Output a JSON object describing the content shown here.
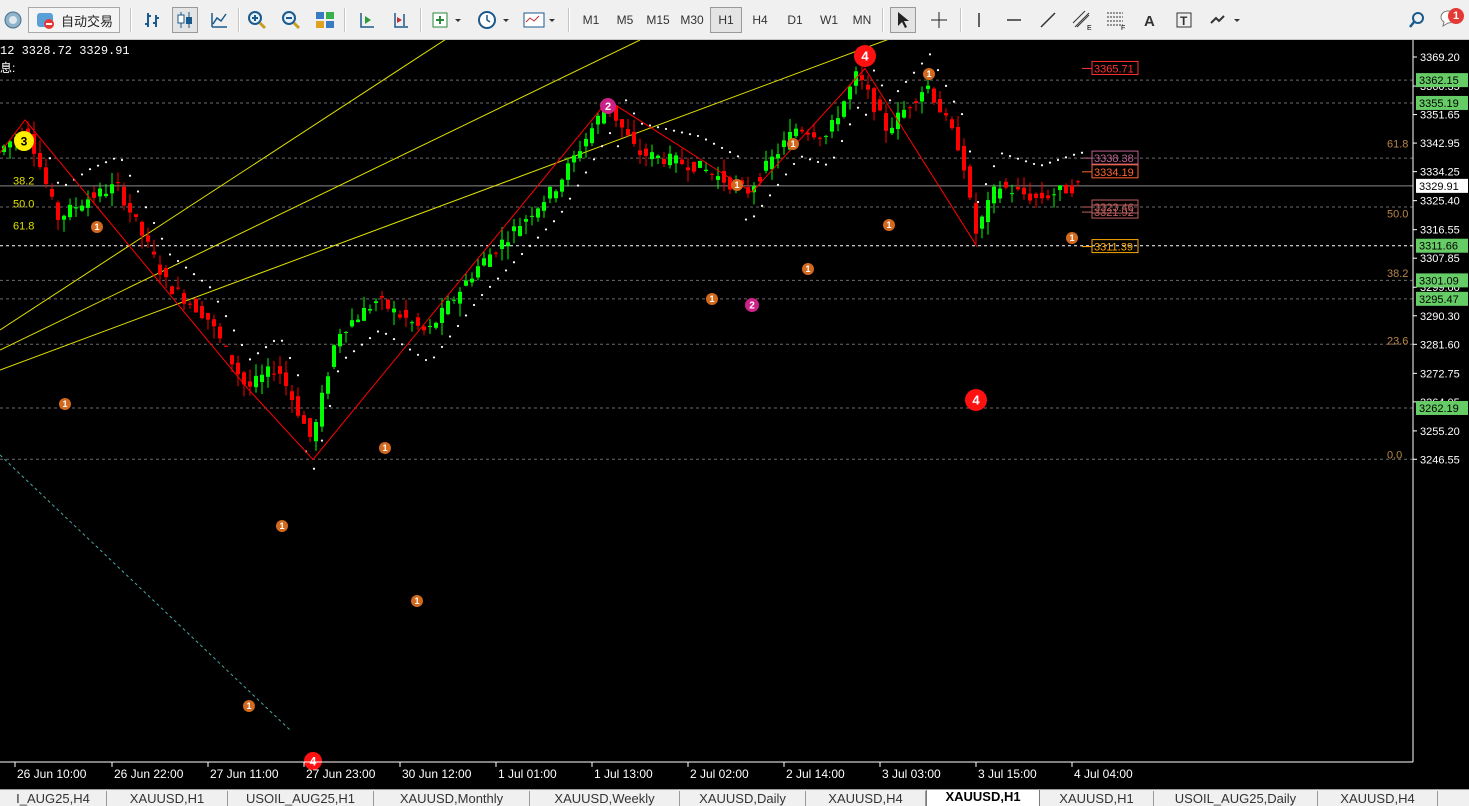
{
  "toolbar": {
    "auto_trade_label": "自动交易",
    "timeframes": [
      "M1",
      "M5",
      "M15",
      "M30",
      "H1",
      "H4",
      "D1",
      "W1",
      "MN"
    ],
    "active_timeframe": "H1",
    "notification_count": "1"
  },
  "chart": {
    "info_line": "12 3328.72 3329.91",
    "info_line2": "息:",
    "price_ticks": [
      "3369.20",
      "3360.35",
      "3351.65",
      "3342.95",
      "3334.25",
      "3325.40",
      "3316.55",
      "3307.85",
      "3299.00",
      "3290.30",
      "3281.60",
      "3272.75",
      "3264.05",
      "3255.20",
      "3246.55"
    ],
    "time_labels": [
      "26 Jun 10:00",
      "26 Jun 22:00",
      "27 Jun 11:00",
      "27 Jun 23:00",
      "30 Jun 12:00",
      "1 Jul 01:00",
      "1 Jul 13:00",
      "2 Jul 02:00",
      "2 Jul 14:00",
      "3 Jul 03:00",
      "3 Jul 15:00",
      "4 Jul 04:00"
    ],
    "current_price": "3329.91",
    "level_labels": [
      {
        "text": "3362.15",
        "bg": "#66cc66"
      },
      {
        "text": "3355.19",
        "bg": "#66cc66"
      },
      {
        "text": "3311.66",
        "bg": "#66cc66"
      },
      {
        "text": "3301.09",
        "bg": "#66cc66"
      },
      {
        "text": "3295.47",
        "bg": "#66cc66"
      },
      {
        "text": "3262.19",
        "bg": "#66cc66"
      }
    ],
    "marker_labels": [
      "3365.71",
      "3338.38",
      "3334.19",
      "3323.46",
      "3321.92",
      "3311.39"
    ],
    "fib_right": [
      "61.8",
      "50.0",
      "38.2",
      "23.6",
      "0.0"
    ],
    "fib_left": [
      "38.2",
      "50.0",
      "61.8"
    ],
    "wave_labels": [
      "3",
      "2",
      "4",
      "4",
      "4"
    ],
    "sub_wave_label": "1",
    "colors": {
      "bull": "#00ff00",
      "bear": "#ff0000",
      "zigzag": "#ff0000",
      "fib": "#b8864b",
      "trend": "#e0e000",
      "sar": "#ffffff",
      "grid": "#6b6b6b"
    }
  },
  "tabs": [
    {
      "label": "I_AUG25,H4"
    },
    {
      "label": "XAUUSD,H1"
    },
    {
      "label": "USOIL_AUG25,H1"
    },
    {
      "label": "XAUUSD,Monthly"
    },
    {
      "label": "XAUUSD,Weekly"
    },
    {
      "label": "XAUUSD,Daily"
    },
    {
      "label": "XAUUSD,H4"
    },
    {
      "label": "XAUUSD,H1",
      "active": true
    },
    {
      "label": "XAUUSD,H1"
    },
    {
      "label": "USOIL_AUG25,Daily"
    },
    {
      "label": "XAUUSD,H4"
    }
  ]
}
